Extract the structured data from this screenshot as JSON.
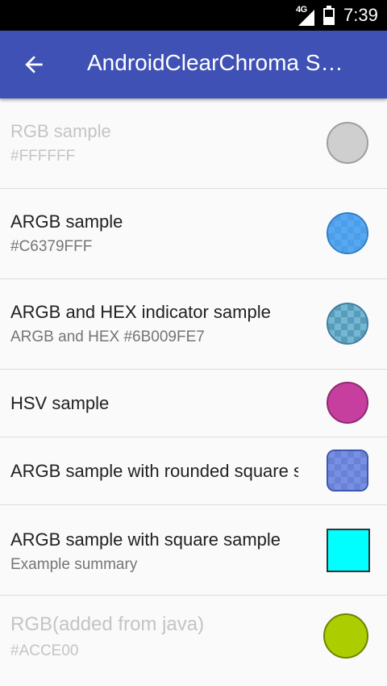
{
  "status_bar": {
    "network": "4G",
    "time": "7:39"
  },
  "app_bar": {
    "back_icon": "arrow-back-icon",
    "title": "AndroidClearChroma Sample"
  },
  "preferences": [
    {
      "title": "RGB sample",
      "summary": "#FFFFFF",
      "enabled": false,
      "shape": "circle",
      "color": "#CFCFCF",
      "border": "#9E9E9E"
    },
    {
      "title": "ARGB sample",
      "summary": "#C6379FFF",
      "enabled": true,
      "shape": "circle",
      "color": "#379FFF",
      "alpha": 0.78,
      "border": "#2E7DC8"
    },
    {
      "title": "ARGB and HEX indicator sample",
      "summary": "ARGB and HEX #6B009FE7",
      "enabled": true,
      "shape": "circle",
      "color": "#009FE7",
      "alpha": 0.42,
      "border": "#3E7FA2"
    },
    {
      "title": "HSV sample",
      "summary": "",
      "enabled": true,
      "shape": "circle",
      "color": "#C63E9E",
      "border": "#8E2A72"
    },
    {
      "title": "ARGB sample with rounded square sample",
      "summary": "",
      "enabled": true,
      "shape": "rounded",
      "color": "#5478F0",
      "alpha": 0.7,
      "border": "#3D57B0"
    },
    {
      "title": "ARGB sample with square sample",
      "summary": "Example summary",
      "enabled": true,
      "shape": "square",
      "color": "#00FFFF",
      "border": "#333333"
    },
    {
      "title": "RGB(added from java)",
      "summary": "#ACCE00",
      "enabled": false,
      "shape": "circle",
      "color": "#ACCE00",
      "border": "#6E8300"
    }
  ]
}
